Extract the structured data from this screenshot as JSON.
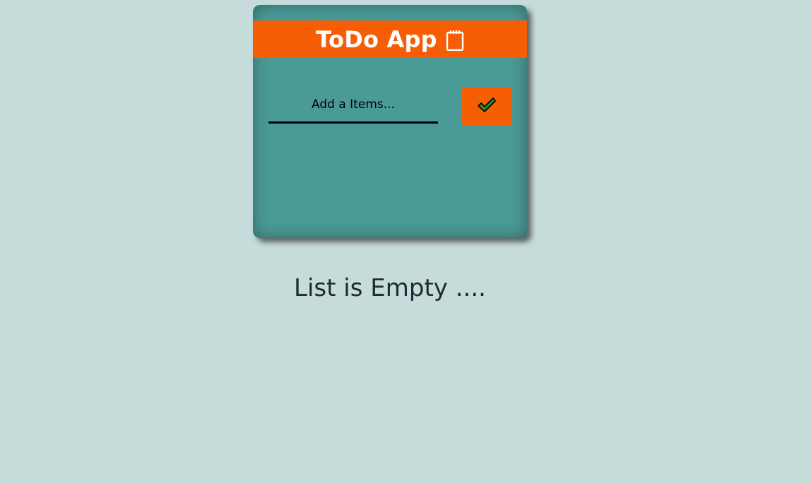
{
  "app": {
    "title": "ToDo App",
    "title_icon": "notepad-icon"
  },
  "input": {
    "placeholder": "Add a Items...",
    "value": ""
  },
  "add_button": {
    "icon": "checkmark-icon"
  },
  "list": {
    "empty_message": "List is Empty ...."
  },
  "colors": {
    "page_background": "#c5dcdb",
    "card_background": "#4a9a97",
    "accent": "#f65e05",
    "check_fill": "#2e8b2e"
  }
}
